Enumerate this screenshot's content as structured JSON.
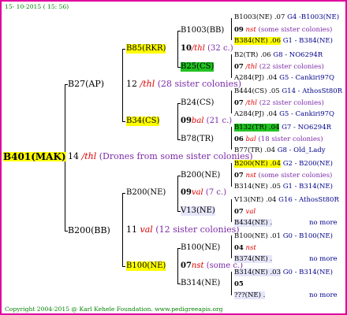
{
  "header": {
    "date": "15- 10-2015 ( 15: 56)"
  },
  "footer": {
    "copyright": "Copyright 2004-2015 @ Karl Kehele Foundation.",
    "site": "www.pedigreeapis.org"
  },
  "root": {
    "label": "B401(MAK)",
    "year": "14",
    "line": "/thl",
    "note": "(Drones from some sister colonies)"
  },
  "g1": {
    "top": {
      "label": "B27(AP)",
      "year": "12",
      "line": "/thl",
      "note": "(28 sister colonies)"
    },
    "bottom": {
      "label": "B200(BB)",
      "year": "11",
      "line": "val",
      "note": "(12 sister colonies)"
    }
  },
  "g2": {
    "a": {
      "label": "B85(RKR)",
      "year": "10",
      "line": "/thl",
      "note": "(32 c.)"
    },
    "b": {
      "label": "B34(CS)",
      "year": "09",
      "line": "bal",
      "note": "(21 c.)"
    },
    "c": {
      "label": "B200(NE)",
      "year": "09",
      "line": "val",
      "note": "(7 c.)"
    },
    "d": {
      "label": "B100(NE)",
      "year": "07",
      "line": "nst",
      "note": "(some c.)"
    }
  },
  "g3": {
    "a1": "B1003(BB)",
    "a2": "B25(CS)",
    "b1": "B24(CS)",
    "b2": "B78(TR)",
    "c1": "B200(NE)",
    "c2": "V13(NE)",
    "d1": "B100(NE)",
    "d2": "B314(NE)"
  },
  "rows": [
    {
      "name": "B1003(NE)",
      "year": ".07",
      "ref": "G4 -B1003(NE)"
    },
    {
      "year": "09",
      "line": "nst",
      "note": "(some sister colonies)"
    },
    {
      "name": "B384(NE)",
      "year": ".06",
      "ref": "G1 - B384(NE)"
    },
    {
      "name": "B2(TR)",
      "year": ".06",
      "ref": "G8 - NO6294R"
    },
    {
      "year": "07",
      "line": "/thl",
      "note": "(22 sister colonies)"
    },
    {
      "name": "A284(PJ)",
      "year": ".04",
      "ref": "G5 - Cankiri97Q"
    },
    {
      "name": "B444(CS)",
      "year": ".05",
      "ref": "G14 - AthosSt80R"
    },
    {
      "year": "07",
      "line": "/thl",
      "note": "(22 sister colonies)"
    },
    {
      "name": "A284(PJ)",
      "year": ".04",
      "ref": "G5 - Cankiri97Q"
    },
    {
      "name": "B132(TR)",
      "year": ".04",
      "ref": "G7 - NO6294R"
    },
    {
      "year": "06",
      "line": "bal",
      "note": "(18 sister colonies)"
    },
    {
      "name": "B77(TR)",
      "year": ".04",
      "ref": "G8 - Old_Lady"
    },
    {
      "name": "B200(NE)",
      "year": ".04",
      "ref": "G2 - B200(NE)"
    },
    {
      "year": "07",
      "line": "nst",
      "note": "(some sister colonies)"
    },
    {
      "name": "B314(NE)",
      "year": ".05",
      "ref": "G1 - B314(NE)"
    },
    {
      "name": "V13(NE)",
      "year": ".04",
      "ref": "G16 - AthosSt80R"
    },
    {
      "year": "07",
      "line": "val"
    },
    {
      "name": "B434(NE)",
      "year": ".",
      "ref": "no more"
    },
    {
      "name": "B100(NE)",
      "year": ".01",
      "ref": "G0 - B100(NE)"
    },
    {
      "year": "04",
      "line": "nst"
    },
    {
      "name": "B374(NE)",
      "year": ".",
      "ref": "no more"
    },
    {
      "name": "B314(NE)",
      "year": ".03",
      "ref": "G0 - B314(NE)"
    },
    {
      "year": "05"
    },
    {
      "name": "???(NE)",
      "year": ".",
      "ref": "no more"
    }
  ]
}
